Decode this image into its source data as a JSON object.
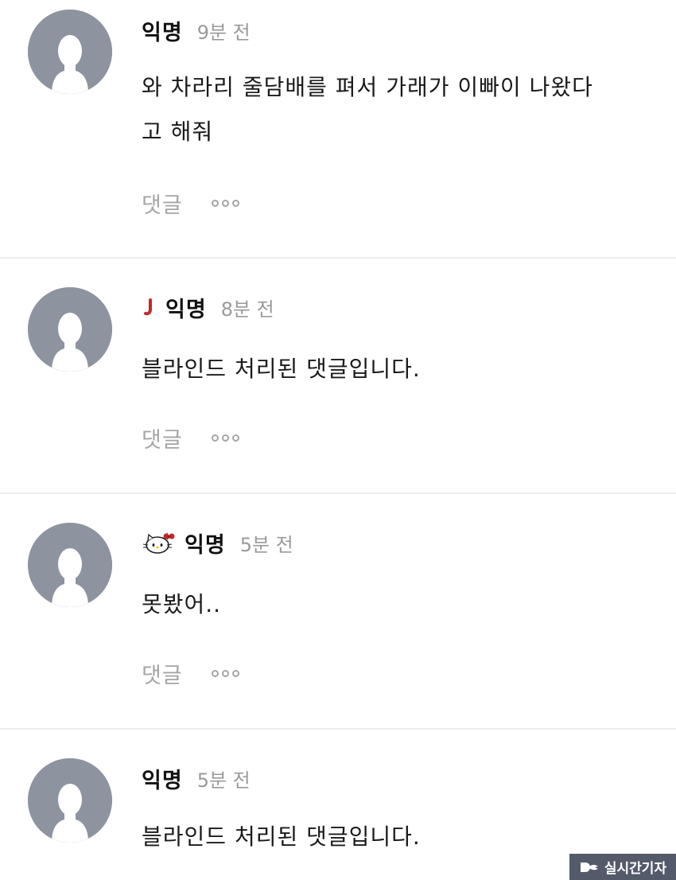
{
  "comments": [
    {
      "author": "익명",
      "time": "9분 전",
      "badge": null,
      "text_lines": [
        "와 차라리 줄담배를 펴서 가래가 이빠이 나왔다",
        "고 해줘"
      ],
      "reply_label": "댓글",
      "more_icon": "more-dots-icon"
    },
    {
      "author": "익명",
      "time": "8분 전",
      "badge": "j-letter-icon",
      "text_lines": [
        "블라인드 처리된 댓글입니다."
      ],
      "reply_label": "댓글",
      "more_icon": "more-dots-icon"
    },
    {
      "author": "익명",
      "time": "5분 전",
      "badge": "hello-kitty-icon",
      "text_lines": [
        "못봤어.."
      ],
      "reply_label": "댓글",
      "more_icon": "more-dots-icon"
    },
    {
      "author": "익명",
      "time": "5분 전",
      "badge": null,
      "text_lines": [
        "블라인드 처리된 댓글입니다."
      ]
    }
  ],
  "watermark": {
    "text": "실시간기자",
    "icon": "reporter-logo-icon"
  },
  "colors": {
    "avatar_bg": "#8e949f",
    "badge_red": "#c62828",
    "muted_text": "#a5a5a5",
    "divider": "#ececec",
    "watermark_bg": "#545a6a"
  }
}
